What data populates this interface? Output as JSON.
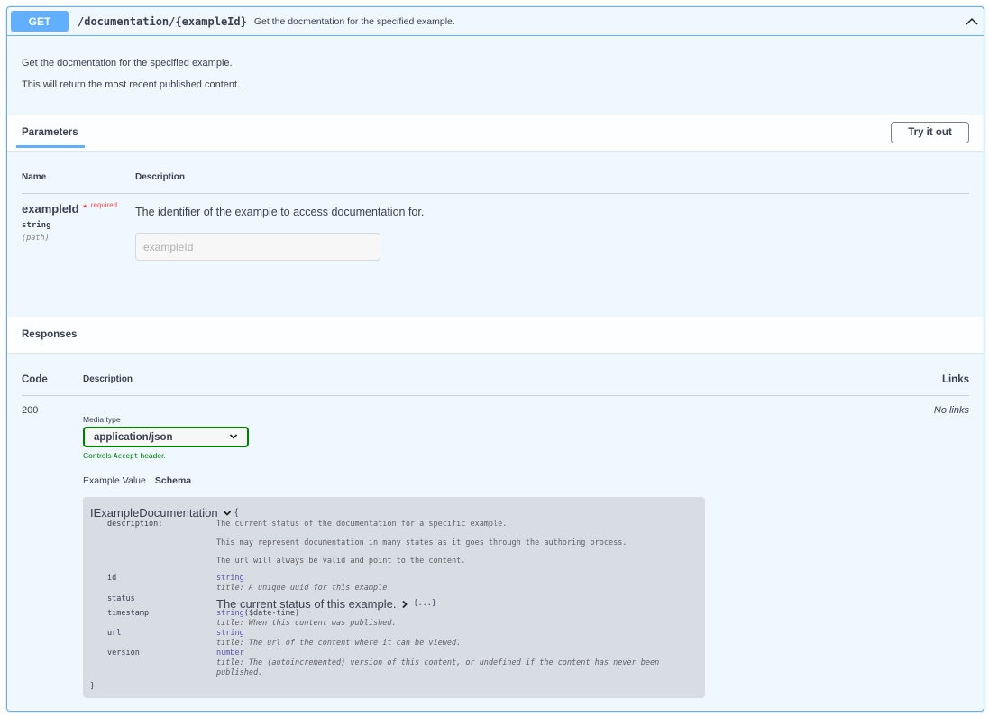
{
  "operation": {
    "method": "GET",
    "path": "/documentation/{exampleId}",
    "summary": "Get the docmentation for the specified example.",
    "description_lines": [
      "Get the docmentation for the specified example.",
      "This will return the most recent published content."
    ],
    "collapse_icon": "chevron-up-icon"
  },
  "parameters": {
    "tab_label": "Parameters",
    "try_button": "Try it out",
    "headers": {
      "name": "Name",
      "description": "Description"
    },
    "items": [
      {
        "name": "exampleId",
        "required_star": "*",
        "required_label": "required",
        "type": "string",
        "in": "(path)",
        "description": "The identifier of the example to access documentation for.",
        "placeholder": "exampleId",
        "value": ""
      }
    ]
  },
  "responses": {
    "title": "Responses",
    "headers": {
      "code": "Code",
      "description": "Description",
      "links": "Links"
    },
    "items": [
      {
        "code": "200",
        "links": "No links",
        "media_type_label": "Media type",
        "media_type_value": "application/json",
        "media_note_prefix": "Controls ",
        "media_note_code": "Accept",
        "media_note_suffix": " header.",
        "example_tab": "Example Value",
        "schema_tab": "Schema",
        "model": {
          "name": "IExampleDocumentation",
          "open_brace": "{",
          "close_brace": "}",
          "description_key": "description:",
          "description_lines": [
            "The current status of the documentation for a specific example.",
            "This may represent documentation in many states as it goes through the authoring process.",
            "The url will always be valid and point to the content."
          ],
          "properties": [
            {
              "key": "id",
              "type": "string",
              "title": "title: A unique uuid for this example."
            },
            {
              "key": "status",
              "ref_title": "The current status of this example.",
              "collapsed": "{...}"
            },
            {
              "key": "timestamp",
              "type": "string",
              "format": "($date-time)",
              "title": "title: When this content was published."
            },
            {
              "key": "url",
              "type": "string",
              "title": "title: The url of the content where it can be viewed."
            },
            {
              "key": "version",
              "type": "number",
              "title": "title: The (autoincremented) version of this content, or undefined if the content has never been published."
            }
          ]
        }
      }
    ]
  },
  "colors": {
    "get_accent": "#61affe",
    "block_bg": "#eff7ff",
    "valid_green": "#008000",
    "required_red": "#ff0000"
  }
}
